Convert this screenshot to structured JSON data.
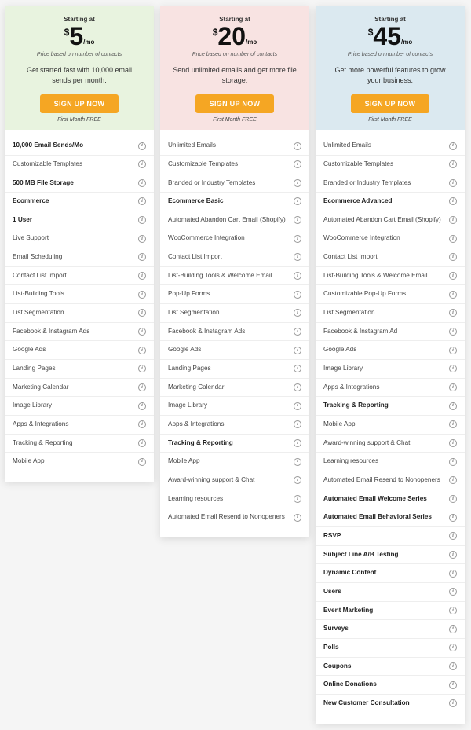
{
  "shared": {
    "starting_at": "Starting at",
    "currency": "$",
    "per": "/mo",
    "price_basis": "Price based on number of contacts",
    "cta": "SIGN UP NOW",
    "free_month": "First Month FREE",
    "accent_color": "#f5a623"
  },
  "plans": [
    {
      "amount": "5",
      "blurb": "Get started fast with 10,000 email sends per month.",
      "bg_color": "#e8f3df",
      "features": [
        {
          "label": "10,000 Email Sends/Mo",
          "bold": true
        },
        {
          "label": "Customizable Templates",
          "bold": false
        },
        {
          "label": "500 MB File Storage",
          "bold": true
        },
        {
          "label": "Ecommerce",
          "bold": true
        },
        {
          "label": "1 User",
          "bold": true
        },
        {
          "label": "Live Support",
          "bold": false
        },
        {
          "label": "Email Scheduling",
          "bold": false
        },
        {
          "label": "Contact List Import",
          "bold": false
        },
        {
          "label": "List-Building Tools",
          "bold": false
        },
        {
          "label": "List Segmentation",
          "bold": false
        },
        {
          "label": "Facebook & Instagram Ads",
          "bold": false
        },
        {
          "label": "Google Ads",
          "bold": false
        },
        {
          "label": "Landing Pages",
          "bold": false
        },
        {
          "label": "Marketing Calendar",
          "bold": false
        },
        {
          "label": "Image Library",
          "bold": false
        },
        {
          "label": "Apps & Integrations",
          "bold": false
        },
        {
          "label": "Tracking & Reporting",
          "bold": false
        },
        {
          "label": "Mobile App",
          "bold": false
        }
      ]
    },
    {
      "amount": "20",
      "blurb": "Send unlimited emails and get more file storage.",
      "bg_color": "#f8e3e2",
      "features": [
        {
          "label": "Unlimited Emails",
          "bold": false
        },
        {
          "label": "Customizable Templates",
          "bold": false
        },
        {
          "label": "Branded or Industry Templates",
          "bold": false
        },
        {
          "label": "Ecommerce Basic",
          "bold": true
        },
        {
          "label": "Automated Abandon Cart Email (Shopify)",
          "bold": false
        },
        {
          "label": "WooCommerce Integration",
          "bold": false
        },
        {
          "label": "Contact List Import",
          "bold": false
        },
        {
          "label": "List-Building Tools & Welcome Email",
          "bold": false
        },
        {
          "label": "Pop-Up Forms",
          "bold": false
        },
        {
          "label": "List Segmentation",
          "bold": false
        },
        {
          "label": "Facebook & Instagram Ads",
          "bold": false
        },
        {
          "label": "Google Ads",
          "bold": false
        },
        {
          "label": "Landing Pages",
          "bold": false
        },
        {
          "label": "Marketing Calendar",
          "bold": false
        },
        {
          "label": "Image Library",
          "bold": false
        },
        {
          "label": "Apps & Integrations",
          "bold": false
        },
        {
          "label": "Tracking & Reporting",
          "bold": true
        },
        {
          "label": "Mobile App",
          "bold": false
        },
        {
          "label": "Award-winning support & Chat",
          "bold": false
        },
        {
          "label": "Learning resources",
          "bold": false
        },
        {
          "label": "Automated Email Resend to Nonopeners",
          "bold": false
        }
      ]
    },
    {
      "amount": "45",
      "blurb": "Get more powerful features to grow your business.",
      "bg_color": "#dbe9f0",
      "features": [
        {
          "label": "Unlimited Emails",
          "bold": false
        },
        {
          "label": "Customizable Templates",
          "bold": false
        },
        {
          "label": "Branded or Industry Templates",
          "bold": false
        },
        {
          "label": "Ecommerce Advanced",
          "bold": true
        },
        {
          "label": "Automated Abandon Cart Email (Shopify)",
          "bold": false
        },
        {
          "label": "WooCommerce Integration",
          "bold": false
        },
        {
          "label": "Contact List Import",
          "bold": false
        },
        {
          "label": "List-Building Tools & Welcome Email",
          "bold": false
        },
        {
          "label": "Customizable Pop-Up Forms",
          "bold": false
        },
        {
          "label": "List Segmentation",
          "bold": false
        },
        {
          "label": "Facebook & Instagram Ad",
          "bold": false
        },
        {
          "label": "Google Ads",
          "bold": false
        },
        {
          "label": "Image Library",
          "bold": false
        },
        {
          "label": "Apps & Integrations",
          "bold": false
        },
        {
          "label": "Tracking & Reporting",
          "bold": true
        },
        {
          "label": "Mobile App",
          "bold": false
        },
        {
          "label": "Award-winning support & Chat",
          "bold": false
        },
        {
          "label": "Learning resources",
          "bold": false
        },
        {
          "label": "Automated Email Resend to Nonopeners",
          "bold": false
        },
        {
          "label": "Automated Email Welcome Series",
          "bold": true
        },
        {
          "label": "Automated Email Behavioral Series",
          "bold": true
        },
        {
          "label": "RSVP",
          "bold": true
        },
        {
          "label": "Subject Line A/B Testing",
          "bold": true
        },
        {
          "label": "Dynamic Content",
          "bold": true
        },
        {
          "label": "Users",
          "bold": true
        },
        {
          "label": "Event Marketing",
          "bold": true
        },
        {
          "label": "Surveys",
          "bold": true
        },
        {
          "label": "Polls",
          "bold": true
        },
        {
          "label": "Coupons",
          "bold": true
        },
        {
          "label": "Online Donations",
          "bold": true
        },
        {
          "label": "New Customer Consultation",
          "bold": true
        }
      ]
    }
  ]
}
